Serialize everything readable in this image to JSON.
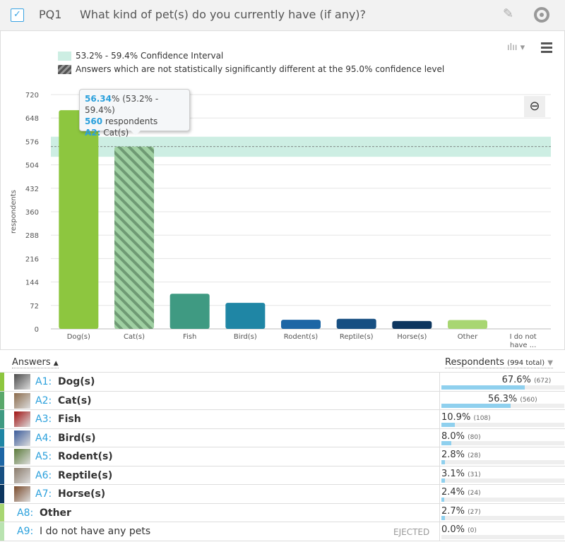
{
  "header": {
    "question_id": "PQ1",
    "question_text": "What kind of pet(s) do you currently have (if any)?",
    "checkbox_checked": true
  },
  "legend": {
    "ci_label": "53.2% - 59.4% Confidence Interval",
    "hatch_label": "Answers which are not statistically significantly different at the 95.0% confidence level",
    "ci_color": "#cdeee3"
  },
  "tooltip": {
    "pct": "56.34",
    "pct_suffix": "%",
    "range": "(53.2% - 59.4%)",
    "count": "560",
    "count_suffix": " respondents",
    "code": "A2:",
    "label": "Cat(s)"
  },
  "chart_data": {
    "type": "bar",
    "xlabel": "",
    "ylabel": "respondents",
    "ylim": [
      0,
      720
    ],
    "yticks": [
      0,
      72,
      144,
      216,
      288,
      360,
      432,
      504,
      576,
      648,
      720
    ],
    "grid": true,
    "categories": [
      "Dog(s)",
      "Cat(s)",
      "Fish",
      "Bird(s)",
      "Rodent(s)",
      "Reptile(s)",
      "Horse(s)",
      "Other",
      "I do not have ..."
    ],
    "values": [
      672,
      560,
      108,
      80,
      28,
      31,
      24,
      27,
      0
    ],
    "colors": [
      "#8dc63f",
      "#9fd0a2",
      "#3f9a82",
      "#1f86a5",
      "#1d66a5",
      "#174f82",
      "#0d365f",
      "#a8d672",
      "#cccccc"
    ],
    "hatched": [
      false,
      true,
      false,
      false,
      false,
      false,
      false,
      false,
      false
    ],
    "confidence_interval": [
      53.2,
      59.4
    ],
    "reference_value": 560
  },
  "table": {
    "answers_header": "Answers",
    "answers_sort": "▲",
    "respondents_header": "Respondents",
    "total": "(994 total)",
    "resp_sort": "▼",
    "rows": [
      {
        "code": "A1:",
        "label": "Dog(s)",
        "pct": "67.6%",
        "count": "(672)",
        "value": 67.6,
        "color": "#8dc63f",
        "thumb": "#4a4a4a",
        "img": true
      },
      {
        "code": "A2:",
        "label": "Cat(s)",
        "pct": "56.3%",
        "count": "(560)",
        "value": 56.3,
        "color": "#5aa86b",
        "thumb": "#8a6a4a",
        "img": true
      },
      {
        "code": "A3:",
        "label": "Fish",
        "pct": "10.9%",
        "count": "(108)",
        "value": 10.9,
        "color": "#3f9a82",
        "thumb": "#a01010",
        "img": true
      },
      {
        "code": "A4:",
        "label": "Bird(s)",
        "pct": "8.0%",
        "count": "(80)",
        "value": 8.0,
        "color": "#1f86a5",
        "thumb": "#3a5a9a",
        "img": true
      },
      {
        "code": "A5:",
        "label": "Rodent(s)",
        "pct": "2.8%",
        "count": "(28)",
        "value": 2.8,
        "color": "#1d66a5",
        "thumb": "#5a7a3a",
        "img": true
      },
      {
        "code": "A6:",
        "label": "Reptile(s)",
        "pct": "3.1%",
        "count": "(31)",
        "value": 3.1,
        "color": "#174f82",
        "thumb": "#8a7a6a",
        "img": true
      },
      {
        "code": "A7:",
        "label": "Horse(s)",
        "pct": "2.4%",
        "count": "(24)",
        "value": 2.4,
        "color": "#0d365f",
        "thumb": "#7a4a2a",
        "img": true
      },
      {
        "code": "A8:",
        "label": "Other",
        "pct": "2.7%",
        "count": "(27)",
        "value": 2.7,
        "color": "#a8d672",
        "img": false
      },
      {
        "code": "A9:",
        "label": "I do not have any pets",
        "pct": "0.0%",
        "count": "(0)",
        "value": 0,
        "color": "#b9e3b0",
        "img": false,
        "status": "EJECTED"
      }
    ]
  }
}
